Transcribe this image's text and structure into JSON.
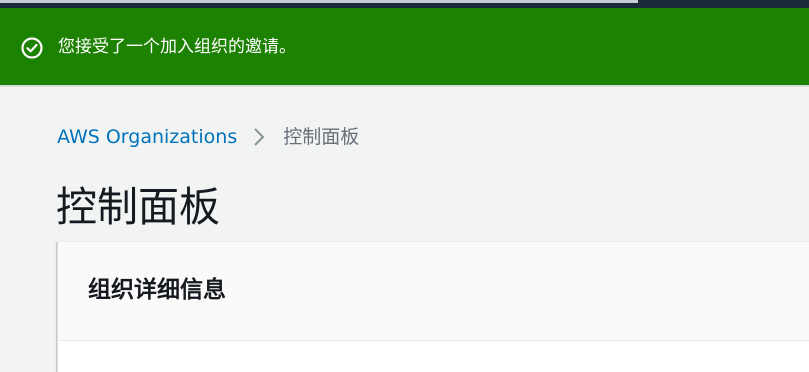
{
  "flash": {
    "message": "您接受了一个加入组织的邀请。",
    "icon": "check-circle-icon",
    "color": "#1d8102"
  },
  "breadcrumb": {
    "items": [
      "AWS Organizations",
      "控制面板"
    ],
    "separator_icon": "chevron-right-icon"
  },
  "page": {
    "title": "控制面板"
  },
  "card": {
    "title": "组织详细信息"
  },
  "colors": {
    "link": "#0073bb",
    "background": "#f2f3f3",
    "text": "#16191f",
    "muted": "#687078"
  }
}
